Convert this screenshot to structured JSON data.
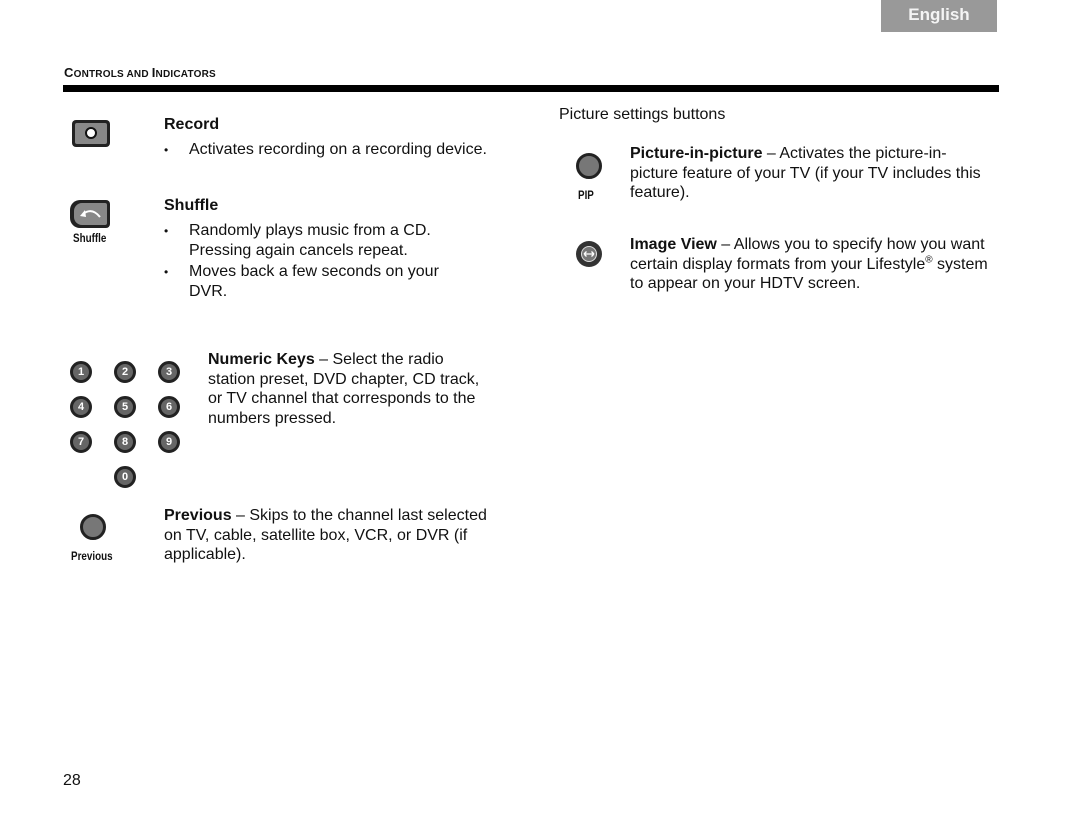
{
  "header": {
    "language_tab": "English",
    "section_title_first_cap": "C",
    "section_title_part1": "ONTROLS AND ",
    "section_title_second_cap": "I",
    "section_title_part2": "NDICATORS"
  },
  "left": {
    "record": {
      "title": "Record",
      "bullets": [
        "Activates recording on a recording device."
      ]
    },
    "shuffle": {
      "icon_label": "Shuffle",
      "title": "Shuffle",
      "bullets": [
        "Randomly plays music from a CD. Pressing again cancels repeat.",
        "Moves back a few seconds on your DVR."
      ]
    },
    "numeric": {
      "keys": [
        "1",
        "2",
        "3",
        "4",
        "5",
        "6",
        "7",
        "8",
        "9",
        "0"
      ],
      "title": "Numeric Keys",
      "desc": " – Select the radio station preset, DVD chapter, CD track, or TV channel that corresponds to the numbers pressed."
    },
    "previous": {
      "icon_label": "Previous",
      "title": "Previous",
      "desc": " – Skips to the channel last selected on TV, cable, satellite box, VCR, or DVR (if applicable)."
    }
  },
  "right": {
    "heading": "Picture settings buttons",
    "pip": {
      "icon_label": "PIP",
      "title": "Picture-in-picture",
      "desc": " – Activates the picture-in-picture feature of your TV (if your TV includes this feature)."
    },
    "image_view": {
      "title": "Image View",
      "desc_a": " – Allows you to specify how you want certain display formats from your Lifestyle",
      "reg": "®",
      "desc_b": " system to appear on your HDTV screen."
    }
  },
  "footer": {
    "page_number": "28"
  }
}
